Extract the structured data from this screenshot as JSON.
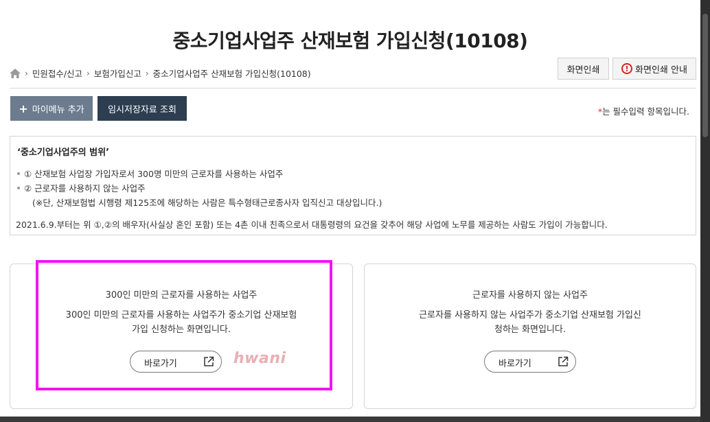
{
  "page_title": "중소기업사업주 산재보험 가입신청(10108)",
  "breadcrumb": [
    "민원접수/신고",
    "보험가입신고",
    "중소기업사업주 산재보험 가입신청(10108)"
  ],
  "print_buttons": {
    "print": "화면인쇄",
    "print_guide": "화면인쇄 안내"
  },
  "toolbar": {
    "add_mymenu": "마이메뉴 추가",
    "temp_saved": "임시저장자료 조회"
  },
  "required_note": {
    "star": "*",
    "text": "는 필수입력 항목입니다."
  },
  "info": {
    "title": "‘중소기업사업주의 범위’",
    "item1": "① 산재보험 사업장 가입자로서 300명 미만의 근로자를 사용하는 사업주",
    "item2": "② 근로자를 사용하지 않는 사업주",
    "note": "(※단, 산재보험법 시행령 제125조에 해당하는 사람은 특수형태근로종사자 입직신고 대상입니다.)",
    "footer": "2021.6.9.부터는 위 ①,②의 배우자(사실상 혼인 포함) 또는 4촌 이내 친족으로서 대통령령의 요건을 갖추어 해당 사업에 노무를 제공하는 사람도 가입이 가능합니다."
  },
  "cards": [
    {
      "title": "300인 미만의 근로자를 사용하는 사업주",
      "desc_line1": "300인 미만의 근로자를 사용하는 사업주가 중소기업 산재보험",
      "desc_line2": "가입 신청하는 화면입니다.",
      "button": "바로가기"
    },
    {
      "title": "근로자를 사용하지 않는 사업주",
      "desc_line1": "근로자를 사용하지 않는 사업주가 중소기업 산재보험 가입신",
      "desc_line2": "청하는 화면입니다.",
      "button": "바로가기"
    }
  ],
  "watermark": "hwani",
  "colors": {
    "highlight": "#f213f2",
    "dark_button": "#2d3e50",
    "grey_button": "#6c7c8e",
    "required_star": "#e0262b"
  }
}
